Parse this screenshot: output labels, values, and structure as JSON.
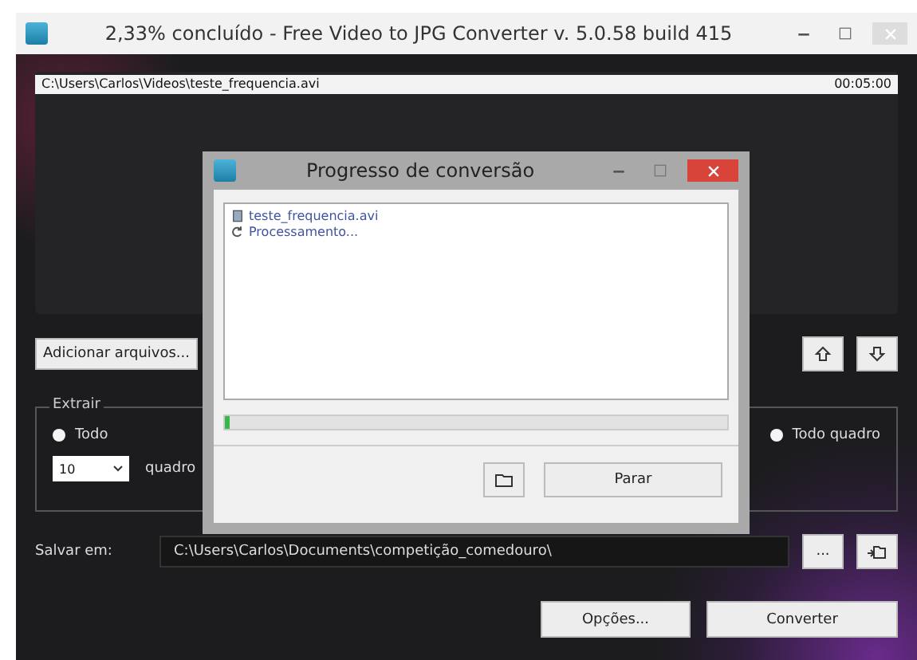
{
  "window": {
    "title": "2,33% concluído - Free Video to JPG Converter  v. 5.0.58 build 415"
  },
  "file_bar": {
    "path": "C:\\Users\\Carlos\\Videos\\teste_frequencia.avi",
    "duration": "00:05:00"
  },
  "add_button": "Adicionar arquivos...",
  "extract": {
    "legend": "Extrair",
    "count": "10",
    "count_unit": "quadro",
    "options": [
      {
        "label": "Todo",
        "selected": false
      },
      {
        "label": "Todo quadro",
        "selected": false
      }
    ]
  },
  "save": {
    "label": "Salvar em:",
    "path": "C:\\Users\\Carlos\\Documents\\competição_comedouro\\",
    "browse": "..."
  },
  "buttons": [
    "Opções...",
    "Converter"
  ],
  "dialog": {
    "title": "Progresso de conversão",
    "items": [
      {
        "kind": "file",
        "text": "teste_frequencia.avi"
      },
      {
        "kind": "status",
        "text": "Processamento..."
      }
    ],
    "progress": {
      "level": 0.01
    },
    "stop_button": "Parar"
  }
}
